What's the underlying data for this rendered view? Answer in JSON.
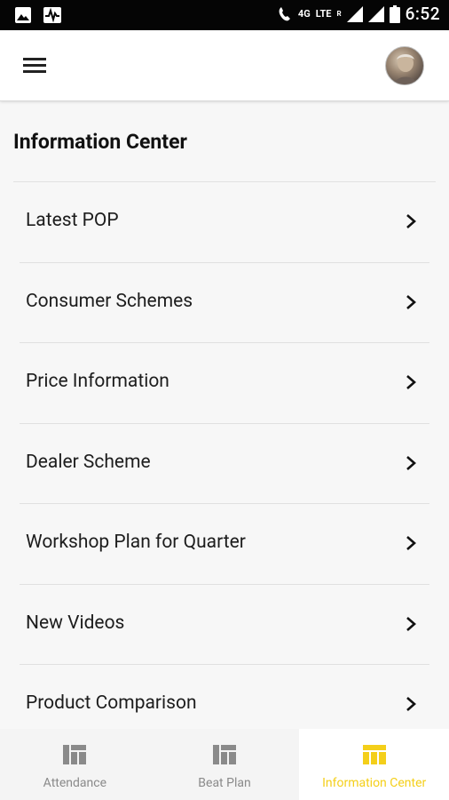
{
  "status_bar": {
    "network_label": "4G",
    "lte_label": "LTE",
    "roaming_label": "R",
    "time": "6:52"
  },
  "header": {
    "menu_icon": "hamburger-menu-icon",
    "avatar_icon": "user-avatar"
  },
  "page": {
    "title": "Information Center"
  },
  "menu": {
    "items": [
      {
        "label": "Latest POP"
      },
      {
        "label": "Consumer Schemes"
      },
      {
        "label": "Price Information"
      },
      {
        "label": "Dealer Scheme"
      },
      {
        "label": "Workshop Plan for Quarter"
      },
      {
        "label": "New Videos"
      },
      {
        "label": "Product Comparison"
      }
    ]
  },
  "bottom_nav": {
    "active_color": "#f4cf1a",
    "inactive_color": "#8a8a8a",
    "tabs": [
      {
        "label": "Attendance",
        "icon": "dashboard-icon",
        "active": false
      },
      {
        "label": "Beat Plan",
        "icon": "dashboard-icon",
        "active": false
      },
      {
        "label": "Information Center",
        "icon": "dashboard-icon",
        "active": true
      }
    ]
  }
}
